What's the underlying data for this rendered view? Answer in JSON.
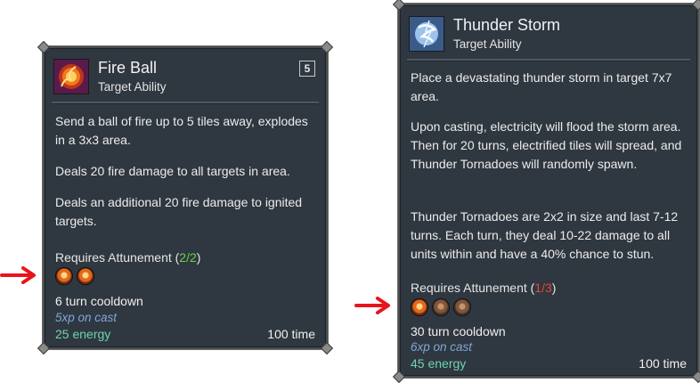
{
  "fireball": {
    "title": "Fire Ball",
    "subtitle": "Target Ability",
    "level": "5",
    "desc1": "Send a ball of fire up to 5 tiles away, explodes in a 3x3 area.",
    "desc2": "Deals 20 fire damage to all targets in area.",
    "desc3": "Deals an additional 20 fire damage to ignited targets.",
    "req_label": "Requires Attunement (",
    "req_value": "2/2",
    "req_close": ")",
    "cooldown": "6 turn cooldown",
    "xp": "5xp on cast",
    "energy": "25 energy",
    "time": "100 time",
    "orbs_filled": 2,
    "orbs_total": 2
  },
  "thunder": {
    "title": "Thunder Storm",
    "subtitle": "Target Ability",
    "desc1": "Place a devastating thunder storm in target 7x7 area.",
    "desc2": "Upon casting, electricity will flood the storm area. Then for 20 turns, electrified tiles will spread, and Thunder Tornadoes will randomly spawn.",
    "desc3": "Thunder Tornadoes are 2x2 in size and last 7-12 turns. Each turn, they deal 10-22 damage to all units within and have a 40% chance to stun.",
    "req_label": "Requires Attunement (",
    "req_value": "1/3",
    "req_close": ")",
    "cooldown": "30 turn cooldown",
    "xp": "6xp on cast",
    "energy": "45 energy",
    "time": "100 time",
    "orbs_filled": 1,
    "orbs_total": 3
  },
  "colors": {
    "card_bg": "#2f3740",
    "req_ok": "#6fd04e",
    "req_missing": "#e04a3c",
    "energy": "#6fd3b0",
    "xp": "#7fa8d8",
    "arrow": "#e8141c"
  }
}
